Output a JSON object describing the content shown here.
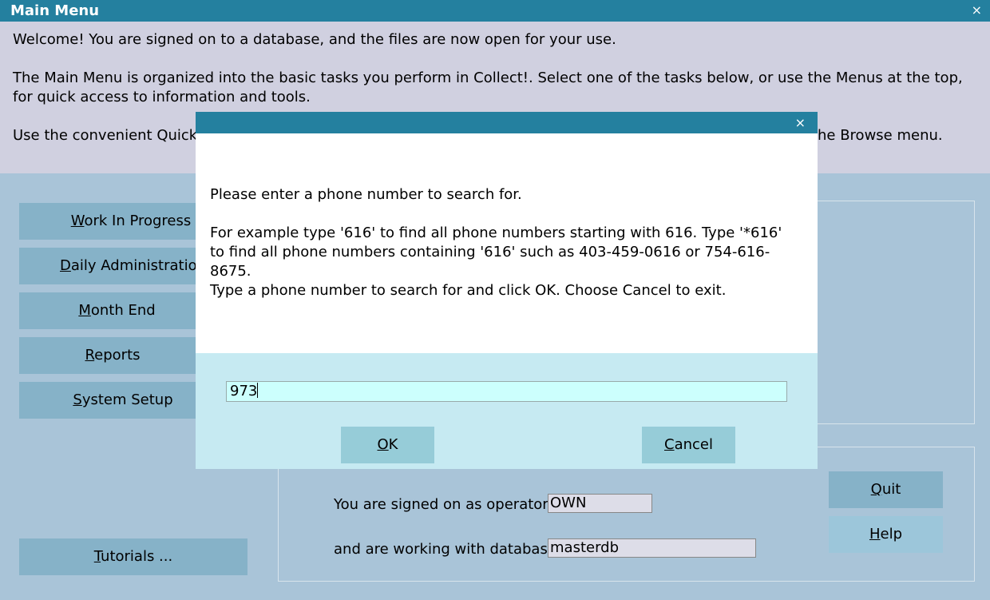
{
  "window": {
    "title": "Main Menu",
    "close_glyph": "×"
  },
  "welcome": {
    "line1": "Welcome! You are signed on to a database, and the files are now open for your use.",
    "line2": "The Main Menu is organized into the basic tasks you perform in Collect!. Select one of the tasks below, or use the Menus at the top, for quick access to information and tools.",
    "line3_left": "Use the convenient Quick S",
    "line3_right": "he Browse menu."
  },
  "tasks": [
    {
      "key": "W",
      "rest": "ork In Progress"
    },
    {
      "key": "D",
      "rest": "aily Administration"
    },
    {
      "key": "M",
      "rest": "onth End"
    },
    {
      "key": "R",
      "rest": "eports"
    },
    {
      "key": "S",
      "rest": "ystem Setup"
    }
  ],
  "tutorials": {
    "key": "T",
    "rest": "utorials ..."
  },
  "status": {
    "operator_label": "You are signed on as operator",
    "operator_value": "OWN",
    "database_label": "and are working with database",
    "database_value": "masterdb"
  },
  "actions": {
    "quit": {
      "key": "Q",
      "rest": "uit"
    },
    "help": {
      "key": "H",
      "rest": "elp"
    }
  },
  "dialog": {
    "close_glyph": "×",
    "prompt": "Please enter a phone number to search for.",
    "example": "For example type '616' to find all phone numbers starting with 616. Type '*616' to find all phone numbers containing '616' such as 403-459-0616 or 754-616-8675.",
    "instruction": "Type a phone number to search for and click OK. Choose Cancel to exit.",
    "input_value": "973",
    "ok": {
      "key": "O",
      "rest": "K"
    },
    "cancel": {
      "key": "C",
      "rest": "ancel"
    }
  }
}
